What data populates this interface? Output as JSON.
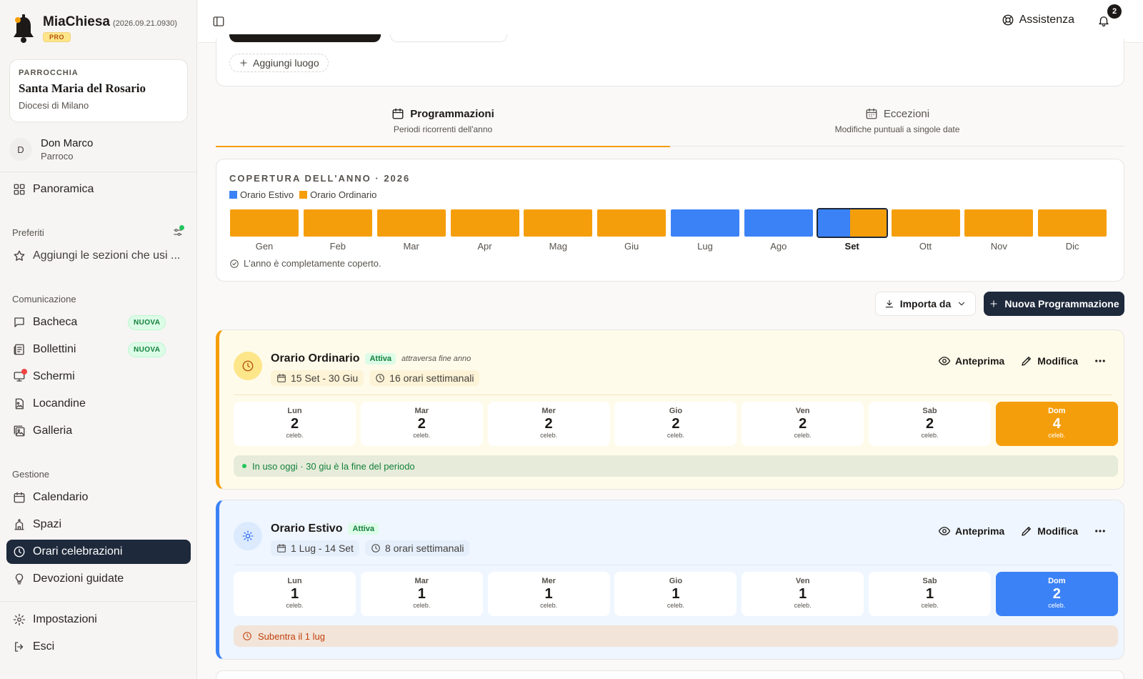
{
  "app": {
    "name": "MiaChiesa",
    "version": "(2026.09.21.0930)",
    "plan": "PRO"
  },
  "parish": {
    "kicker": "PARROCCHIA",
    "name": "Santa Maria del Rosario",
    "diocese": "Diocesi di Milano"
  },
  "user": {
    "initial": "D",
    "name": "Don Marco",
    "role": "Parroco"
  },
  "nav": {
    "overview": "Panoramica",
    "favorites_label": "Preferiti",
    "favorites_hint": "Aggiungi le sezioni che usi ...",
    "communication_label": "Comunicazione",
    "communication": [
      {
        "label": "Bacheca",
        "icon": "message-square-icon",
        "badge": "NUOVA"
      },
      {
        "label": "Bollettini",
        "icon": "newspaper-icon",
        "badge": "NUOVA"
      },
      {
        "label": "Schermi",
        "icon": "monitor-icon",
        "badge": ""
      },
      {
        "label": "Locandine",
        "icon": "file-image-icon",
        "badge": ""
      },
      {
        "label": "Galleria",
        "icon": "images-icon",
        "badge": ""
      }
    ],
    "management_label": "Gestione",
    "management": [
      {
        "label": "Calendario",
        "icon": "calendar-icon"
      },
      {
        "label": "Spazi",
        "icon": "church-icon"
      },
      {
        "label": "Orari celebrazioni",
        "icon": "clock-icon",
        "active": true
      },
      {
        "label": "Devozioni guidate",
        "icon": "lightbulb-icon"
      }
    ],
    "settings": "Impostazioni",
    "logout": "Esci"
  },
  "topbar": {
    "help": "Assistenza",
    "notifications_count": "2"
  },
  "places": {
    "add_label": "Aggiungi luogo"
  },
  "tabs": [
    {
      "title": "Programmazioni",
      "subtitle": "Periodi ricorrenti dell'anno",
      "active": true
    },
    {
      "title": "Eccezioni",
      "subtitle": "Modifiche puntuali a singole date",
      "active": false
    }
  ],
  "coverage": {
    "title": "COPERTURA DELL'ANNO · 2026",
    "legend": [
      {
        "name": "Orario Estivo",
        "color": "#3b82f6"
      },
      {
        "name": "Orario Ordinario",
        "color": "#f59e0b"
      }
    ],
    "months": [
      {
        "label": "Gen",
        "estivo_fraction": 0
      },
      {
        "label": "Feb",
        "estivo_fraction": 0
      },
      {
        "label": "Mar",
        "estivo_fraction": 0
      },
      {
        "label": "Apr",
        "estivo_fraction": 0
      },
      {
        "label": "Mag",
        "estivo_fraction": 0
      },
      {
        "label": "Giu",
        "estivo_fraction": 0
      },
      {
        "label": "Lug",
        "estivo_fraction": 1
      },
      {
        "label": "Ago",
        "estivo_fraction": 1
      },
      {
        "label": "Set",
        "estivo_fraction": 0.47,
        "selected": true
      },
      {
        "label": "Ott",
        "estivo_fraction": 0
      },
      {
        "label": "Nov",
        "estivo_fraction": 0
      },
      {
        "label": "Dic",
        "estivo_fraction": 0
      }
    ],
    "status": "L'anno è completamente coperto."
  },
  "actions": {
    "import": "Importa da",
    "new": "Nuova Programmazione"
  },
  "schedules": [
    {
      "name": "Orario Ordinario",
      "badge": "Attiva",
      "note": "attraversa fine anno",
      "period": "15 Set - 30 Giu",
      "weekly": "16 orari settimanali",
      "preview": "Anteprima",
      "edit": "Modifica",
      "icon": "clock-icon",
      "color": "#f59e0b",
      "days": [
        {
          "name": "Lun",
          "count": "2",
          "unit": "celeb."
        },
        {
          "name": "Mar",
          "count": "2",
          "unit": "celeb."
        },
        {
          "name": "Mer",
          "count": "2",
          "unit": "celeb."
        },
        {
          "name": "Gio",
          "count": "2",
          "unit": "celeb."
        },
        {
          "name": "Ven",
          "count": "2",
          "unit": "celeb."
        },
        {
          "name": "Sab",
          "count": "2",
          "unit": "celeb."
        },
        {
          "name": "Dom",
          "count": "4",
          "unit": "celeb."
        }
      ],
      "status": "In uso oggi · 30 giu è la fine del periodo"
    },
    {
      "name": "Orario Estivo",
      "badge": "Attiva",
      "note": "",
      "period": "1 Lug - 14 Set",
      "weekly": "8 orari settimanali",
      "preview": "Anteprima",
      "edit": "Modifica",
      "icon": "sun-icon",
      "color": "#3b82f6",
      "days": [
        {
          "name": "Lun",
          "count": "1",
          "unit": "celeb."
        },
        {
          "name": "Mar",
          "count": "1",
          "unit": "celeb."
        },
        {
          "name": "Mer",
          "count": "1",
          "unit": "celeb."
        },
        {
          "name": "Gio",
          "count": "1",
          "unit": "celeb."
        },
        {
          "name": "Ven",
          "count": "1",
          "unit": "celeb."
        },
        {
          "name": "Sab",
          "count": "1",
          "unit": "celeb."
        },
        {
          "name": "Dom",
          "count": "2",
          "unit": "celeb."
        }
      ],
      "status": "Subentra il 1 lug"
    }
  ]
}
